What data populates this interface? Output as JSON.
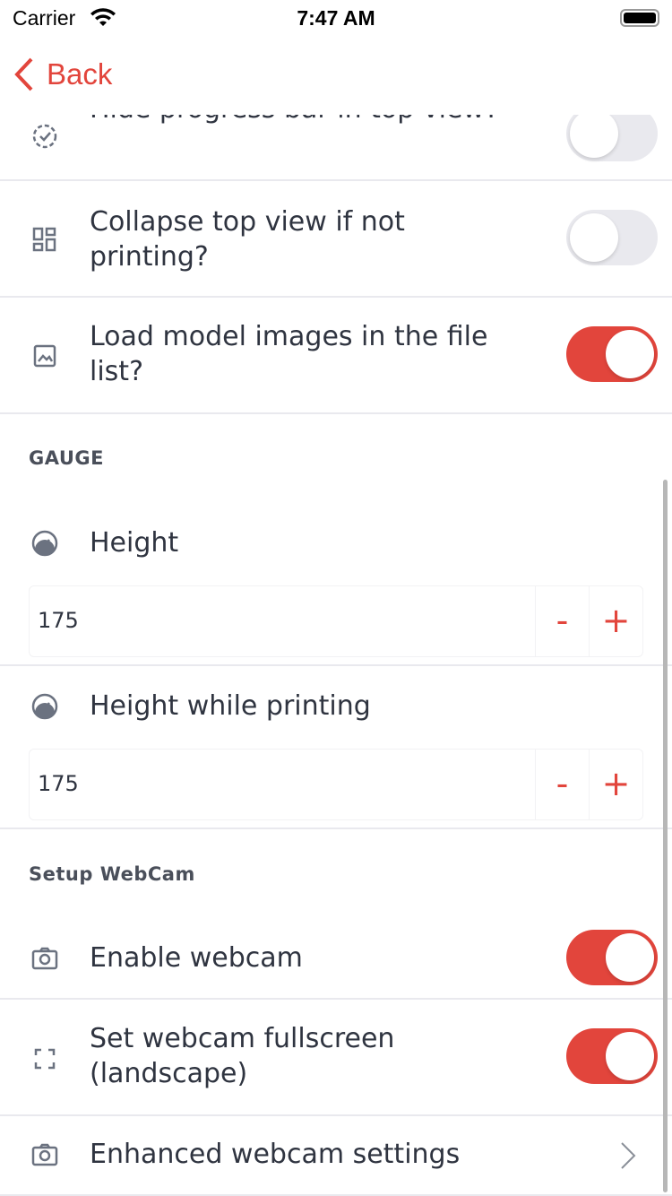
{
  "status_bar": {
    "carrier": "Carrier",
    "time": "7:47 AM"
  },
  "nav": {
    "back_label": "Back"
  },
  "rows_top": [
    {
      "label": "Hide progress bar in top view?",
      "icon": "check-circle-dashed-icon",
      "toggle": false
    },
    {
      "label": "Collapse top view if not printing?",
      "icon": "dashboard-grid-icon",
      "toggle": false
    },
    {
      "label": "Load model images in the file list?",
      "icon": "image-icon",
      "toggle": true
    }
  ],
  "gauge": {
    "header": "GAUGE",
    "height": {
      "label": "Height",
      "value": "175",
      "minus": "-",
      "plus": "+"
    },
    "height_printing": {
      "label": "Height while printing",
      "value": "175",
      "minus": "-",
      "plus": "+"
    }
  },
  "webcam": {
    "header": "Setup WebCam",
    "enable": {
      "label": "Enable webcam",
      "toggle": true
    },
    "fullscreen": {
      "label": "Set webcam fullscreen (landscape)",
      "toggle": true
    },
    "enhanced": {
      "label": "Enhanced webcam settings"
    }
  },
  "colors": {
    "accent": "#e2453c",
    "toggle_off": "#e9e9ee",
    "text": "#2f3440"
  }
}
